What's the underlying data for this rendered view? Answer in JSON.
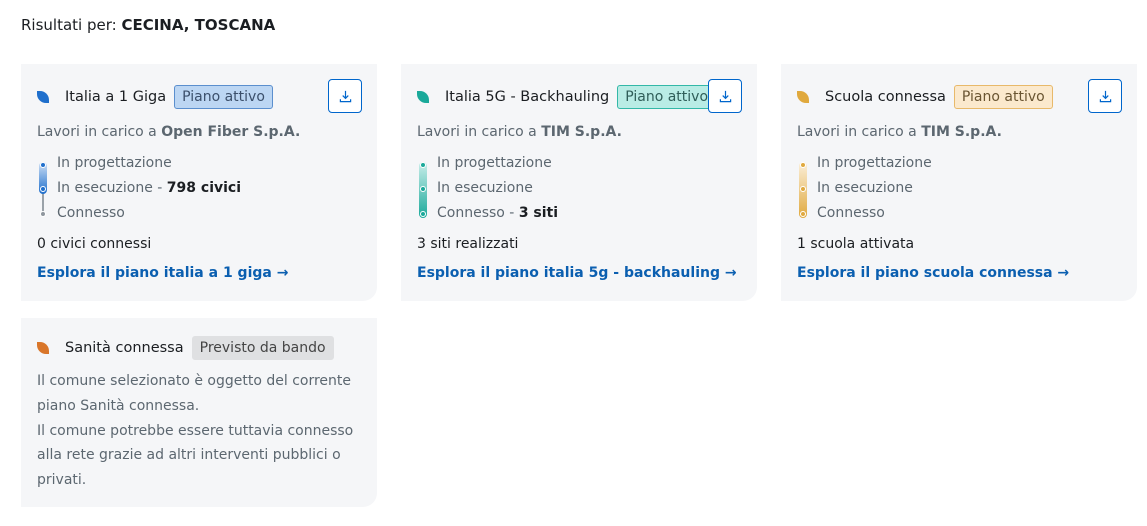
{
  "header": {
    "prefix": "Risultati per: ",
    "location": "CECINA, TOSCANA"
  },
  "cards": [
    {
      "title": "Italia a 1 Giga",
      "badge": "Piano attivo",
      "color": "#1f6fcc",
      "works_prefix": "Lavori in carico a ",
      "company": "Open Fiber S.p.A.",
      "steps": [
        {
          "label": "In progettazione",
          "detail": ""
        },
        {
          "label": "In esecuzione - ",
          "detail": "798 civici"
        },
        {
          "label": "Connesso",
          "detail": ""
        }
      ],
      "current_step": 2,
      "summary": "0 civici connessi",
      "link": "Esplora il piano italia a 1 giga →"
    },
    {
      "title": "Italia 5G - Backhauling",
      "badge": "Piano attivo",
      "color": "#1aa99a",
      "works_prefix": "Lavori in carico a ",
      "company": "TIM S.p.A.",
      "steps": [
        {
          "label": "In progettazione",
          "detail": ""
        },
        {
          "label": "In esecuzione",
          "detail": ""
        },
        {
          "label": "Connesso - ",
          "detail": "3 siti"
        }
      ],
      "current_step": 3,
      "summary": "3 siti realizzati",
      "link": "Esplora il piano italia 5g - backhauling →"
    },
    {
      "title": "Scuola connessa",
      "badge": "Piano attivo",
      "color": "#e0a93e",
      "works_prefix": "Lavori in carico a ",
      "company": "TIM S.p.A.",
      "steps": [
        {
          "label": "In progettazione",
          "detail": ""
        },
        {
          "label": "In esecuzione",
          "detail": ""
        },
        {
          "label": "Connesso",
          "detail": ""
        }
      ],
      "current_step": 3,
      "summary": "1 scuola attivata",
      "link": "Esplora il piano scuola connessa →"
    },
    {
      "title": "Sanità connessa",
      "badge": "Previsto da bando",
      "color": "#d9762a",
      "description_lines": [
        "Il comune selezionato è oggetto del corrente",
        "piano Sanità connessa.",
        "Il comune potrebbe essere tuttavia connesso",
        "alla rete grazie ad altri interventi pubblici o",
        "privati."
      ]
    }
  ],
  "icons": {
    "download": "download-icon",
    "leaf": "leaf-icon",
    "arrow": "arrow-right-icon"
  }
}
